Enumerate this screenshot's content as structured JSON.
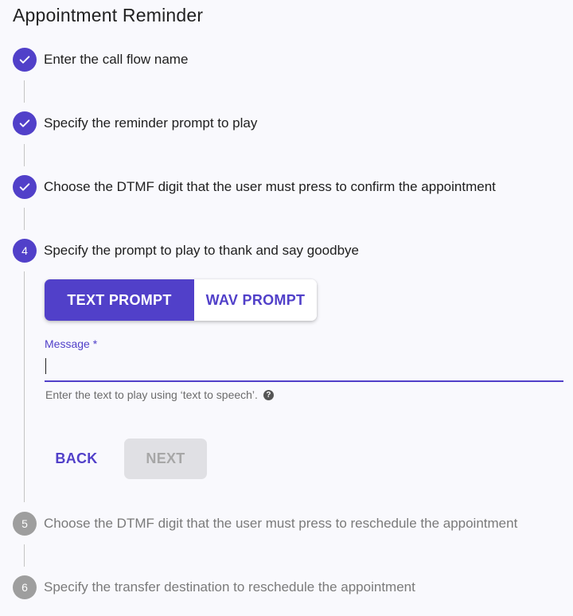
{
  "title": "Appointment Reminder",
  "steps": [
    {
      "badge": "",
      "label": "Enter the call flow name",
      "state": "done"
    },
    {
      "badge": "",
      "label": "Specify the reminder prompt to play",
      "state": "done"
    },
    {
      "badge": "",
      "label": "Choose the DTMF digit that the user must press to confirm the appointment",
      "state": "done"
    },
    {
      "badge": "4",
      "label": "Specify the prompt to play to thank and say goodbye",
      "state": "active"
    },
    {
      "badge": "5",
      "label": "Choose the DTMF digit that the user must press to reschedule the appointment",
      "state": "pending"
    },
    {
      "badge": "6",
      "label": "Specify the transfer destination to reschedule the appointment",
      "state": "pending"
    }
  ],
  "prompt_type": {
    "text_label": "TEXT PROMPT",
    "wav_label": "WAV PROMPT",
    "selected": "TEXT PROMPT"
  },
  "message": {
    "label": "Message *",
    "value": "",
    "helper": "Enter the text to play using ‘text to speech’."
  },
  "nav": {
    "back_label": "BACK",
    "next_label": "NEXT"
  },
  "colors": {
    "accent": "#5140c9",
    "pending": "#9e9e9e",
    "disabled_bg": "#e0e0e4"
  },
  "icons": {
    "done": "check-icon",
    "help": "help-circle-icon"
  }
}
